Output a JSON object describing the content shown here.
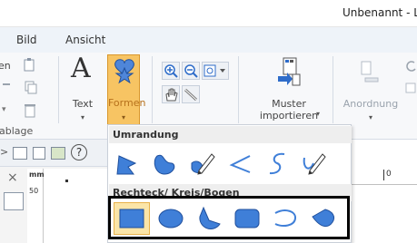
{
  "window": {
    "title": "Unbenannt - L"
  },
  "menu": {
    "items": [
      "Bild",
      "Ansicht"
    ]
  },
  "ribbon": {
    "partial_left_label": "en",
    "clipboard_group_label": "ablage",
    "text_button": {
      "glyph": "A",
      "label": "Text"
    },
    "formen_button": {
      "label": "Formen"
    },
    "muster_button": {
      "label_line1": "Muster",
      "label_line2": "importieren"
    },
    "anordnung_button": {
      "label": "Anordnung"
    }
  },
  "workspace": {
    "close_glyph": "×",
    "ruler_unit": "mm",
    "ruler_left_value": "50",
    "ruler_top_value": "0",
    "help_glyph": "?"
  },
  "dropdown": {
    "section1_title": "Umrandung",
    "section1_icons": [
      "freeform-polygon-icon",
      "freeform-closed-curve-icon",
      "freehand-pencil-icon",
      "open-polyline-icon",
      "open-curve-icon",
      "freehand-open-pencil-icon"
    ],
    "section2_title": "Rechteck/ Kreis/Bogen",
    "section2_icons": [
      "rectangle-icon",
      "ellipse-icon",
      "pie-sector-icon",
      "rounded-rectangle-icon",
      "arc-icon",
      "chord-icon"
    ],
    "selected_shape": "rectangle"
  },
  "colors": {
    "shape_fill": "#3f7fd8",
    "shape_stroke": "#1f4f9c",
    "highlight": "#f7c463",
    "accent_text": "#b7711c"
  }
}
